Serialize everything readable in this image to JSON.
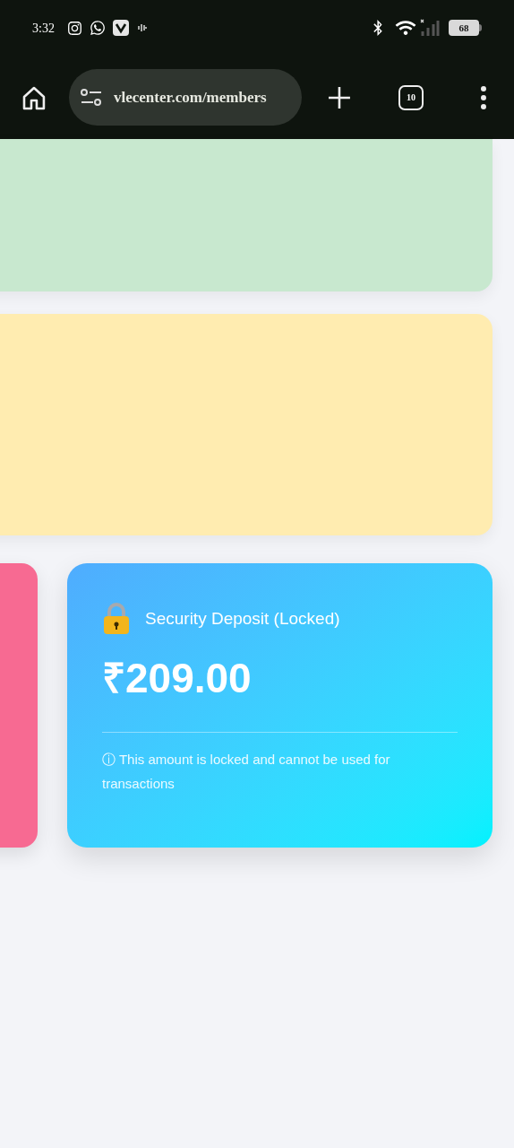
{
  "status_bar": {
    "time": "3:32",
    "battery": "68"
  },
  "browser": {
    "url": "vlecenter.com/members",
    "tab_count": "10"
  },
  "cards": [
    {
      "kind": "blank",
      "color": "#c8e8cf"
    },
    {
      "kind": "blank",
      "color": "#ffecb0"
    },
    {
      "kind": "blank",
      "color": "#f76a92"
    },
    {
      "kind": "deposit",
      "color": "#2ad0fe",
      "title": "Security Deposit (Locked)",
      "amount": "₹209.00",
      "note": "ⓘ This amount is locked and cannot be used for transactions"
    }
  ]
}
